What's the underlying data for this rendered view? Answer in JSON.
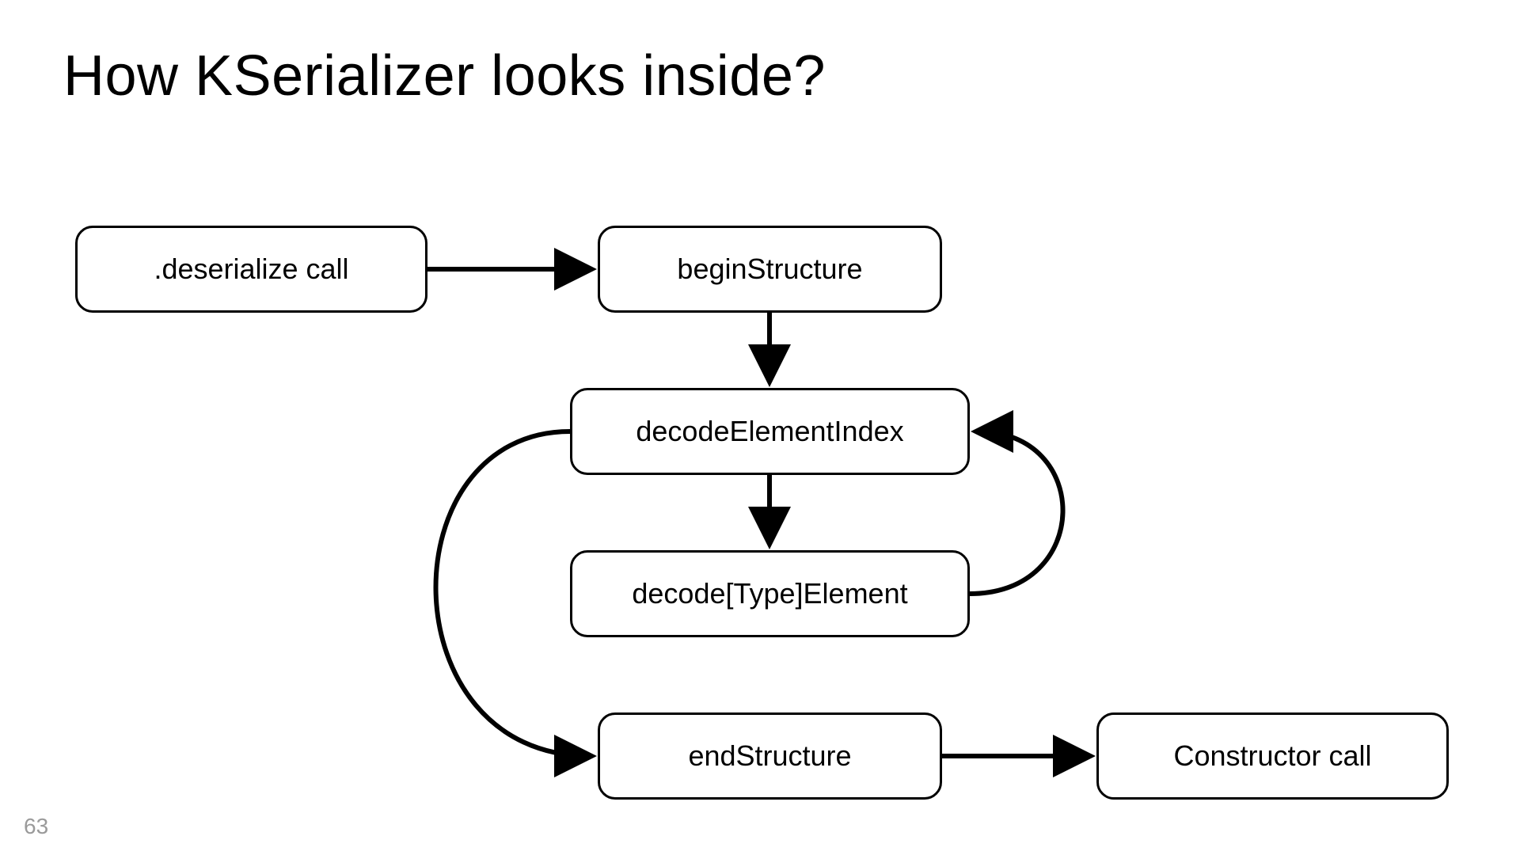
{
  "title": "How KSerializer looks inside?",
  "nodes": {
    "deserialize": ".deserialize call",
    "begin": "beginStructure",
    "decodeIndex": "decodeElementIndex",
    "decodeType": "decode[Type]Element",
    "end": "endStructure",
    "constructor": "Constructor call"
  },
  "page_number": "63"
}
